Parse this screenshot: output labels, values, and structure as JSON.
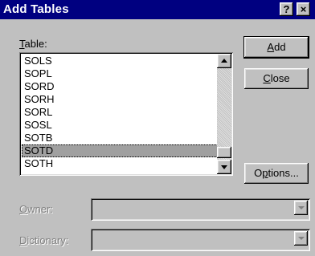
{
  "window": {
    "title": "Add Tables",
    "help_label": "?",
    "close_label": "×"
  },
  "table_label_accel": "T",
  "table_label_rest": "able:",
  "tables": [
    {
      "name": "SOLS"
    },
    {
      "name": "SOPL"
    },
    {
      "name": "SORD"
    },
    {
      "name": "SORH"
    },
    {
      "name": "SORL"
    },
    {
      "name": "SOSL"
    },
    {
      "name": "SOTB"
    },
    {
      "name": "SOTD",
      "selected": true
    },
    {
      "name": "SOTH"
    }
  ],
  "buttons": {
    "add_accel": "A",
    "add_rest": "dd",
    "close_accel": "C",
    "close_rest": "lose",
    "options_pre": "O",
    "options_accel": "p",
    "options_rest": "tions..."
  },
  "owner": {
    "label_accel": "O",
    "label_rest": "wner:",
    "value": ""
  },
  "dictionary": {
    "label_accel": "D",
    "label_rest": "ictionary:",
    "value": ""
  }
}
